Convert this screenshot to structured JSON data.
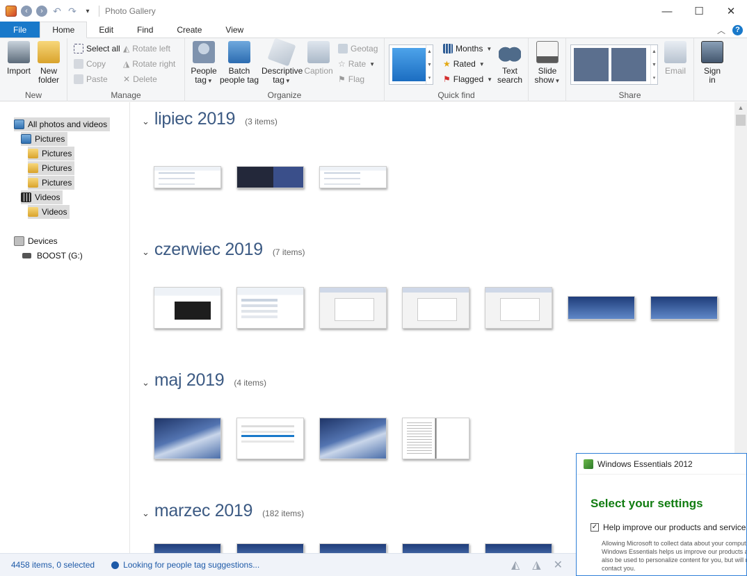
{
  "window": {
    "title": "Photo Gallery",
    "controls": {
      "minimize": "—",
      "maximize": "☐",
      "close": "✕"
    }
  },
  "tabs": [
    "File",
    "Home",
    "Edit",
    "Find",
    "Create",
    "View"
  ],
  "ribbon": {
    "new": {
      "group": "New",
      "import": "Import",
      "new_folder_1": "New",
      "new_folder_2": "folder"
    },
    "manage": {
      "group": "Manage",
      "select_all": "Select all",
      "copy": "Copy",
      "paste": "Paste",
      "rotate_left": "Rotate left",
      "rotate_right": "Rotate right",
      "delete": "Delete"
    },
    "organize": {
      "group": "Organize",
      "people_tag_1": "People",
      "people_tag_2": "tag",
      "batch_1": "Batch",
      "batch_2": "people tag",
      "descriptive_1": "Descriptive",
      "descriptive_2": "tag",
      "caption": "Caption",
      "geotag": "Geotag",
      "rate": "Rate",
      "flag": "Flag"
    },
    "quickfind": {
      "group": "Quick find",
      "months": "Months",
      "rated": "Rated",
      "flagged": "Flagged",
      "text_search_1": "Text",
      "text_search_2": "search"
    },
    "slideshow": {
      "line1": "Slide",
      "line2": "show"
    },
    "share": {
      "group": "Share",
      "email": "Email",
      "sign_in_1": "Sign",
      "sign_in_2": "in"
    }
  },
  "sidebar": {
    "all": "All photos and videos",
    "pictures": "Pictures",
    "pictures_sub": [
      "Pictures",
      "Pictures",
      "Pictures"
    ],
    "videos": "Videos",
    "videos_sub": "Videos",
    "devices": "Devices",
    "drive": "BOOST (G:)"
  },
  "sections": [
    {
      "month": "lipiec 2019",
      "count": "(3 items)"
    },
    {
      "month": "czerwiec 2019",
      "count": "(7 items)"
    },
    {
      "month": "maj 2019",
      "count": "(4 items)"
    },
    {
      "month": "marzec 2019",
      "count": "(182 items)"
    }
  ],
  "status": {
    "count": "4458 items, 0 selected",
    "message": "Looking for people tag suggestions..."
  },
  "dialog": {
    "title": "Windows Essentials 2012",
    "heading": "Select your settings",
    "checkbox_label": "Help improve our products and services",
    "checked": true,
    "description": "Allowing Microsoft to collect data about your computer... Windows Essentials helps us improve our products and... also be used to personalize content for you, but will no... contact you."
  },
  "colors": {
    "accent": "#1979ca",
    "month_heading": "#3c5a83",
    "dialog_heading": "#107c10"
  }
}
